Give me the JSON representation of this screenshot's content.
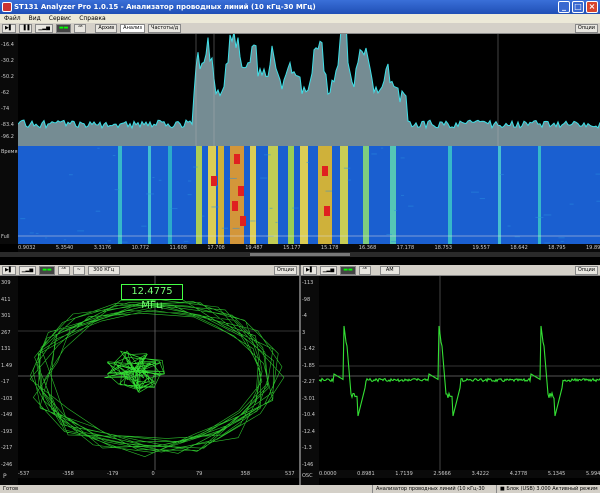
{
  "window": {
    "title": "ST131 Analyzer Pro 1.0.15 - Анализатор проводных линий (10 кГц-30 МГц)",
    "buttons": [
      "_",
      "□",
      "×"
    ]
  },
  "menu": {
    "items": [
      "Файл",
      "Вид",
      "Сервис",
      "Справка"
    ]
  },
  "top_toolbar": {
    "buttons": [
      "▶▌",
      "▐▐",
      "▁▂▅",
      "▬▬",
      "ᴬᴮ"
    ],
    "tabs": [
      "Архив",
      "Анализ",
      "Частоты/д"
    ],
    "options_label": "Опции"
  },
  "spectrum": {
    "y_ticks": [
      "-16.4",
      "-30.2",
      "-50.2",
      "-62",
      "-74",
      "-83.4",
      "-96.2"
    ],
    "waterfall_label": "Время",
    "bottom_label": "Full",
    "x_ticks": [
      "0.9032",
      "5.3540",
      "3.3176",
      "10.772",
      "11.608",
      "17.708",
      "19.487",
      "15.177",
      "15.178",
      "16.368",
      "17.178",
      "18.753",
      "19.557",
      "18.642",
      "18.795",
      "19.897"
    ]
  },
  "left_panel": {
    "toolbar": {
      "buttons": [
        "▶▌",
        "▁▂▅",
        "▬▬",
        "ᴬᴮ",
        "~"
      ],
      "bandwidth": "300 КГц",
      "options_label": "Опции"
    },
    "freq_label": "12.4775 МГц",
    "y_ticks": [
      "309",
      "411",
      "301",
      "267",
      "131",
      "1.49",
      "-17",
      "-103",
      "-149",
      "-193",
      "-217",
      "-246"
    ],
    "x_ticks": [
      "-537",
      "-358",
      "-179",
      "0",
      "79",
      "358",
      "537"
    ],
    "corner_label": "Р"
  },
  "right_panel": {
    "toolbar": {
      "buttons": [
        "▶▌",
        "▁▂▅",
        "▬▬",
        "ᴬᴮ"
      ],
      "mode": "АМ",
      "options_label": "Опции"
    },
    "y_ticks": [
      "-113",
      "-98",
      "-4",
      "3",
      "-1.42",
      "-1.85",
      "-2.27",
      "-3.01",
      "-10.4",
      "-12.4",
      "-1.3",
      "-146"
    ],
    "x_ticks": [
      "0.0000",
      "0.8981",
      "1.7139",
      "2.5666",
      "3.4222",
      "4.2778",
      "5.1345",
      "5.9946"
    ],
    "corner_label": "ОSC"
  },
  "status": {
    "left": "Готов",
    "mid": "Анализатор проводных линий (10 кГц-30 МГц)",
    "right": "■ Блок (USB) 3.000 Активный режим"
  },
  "colors": {
    "spectrum": "#3fe0e8",
    "spectrum_fill": "#8aa4ad",
    "trace": "#34e034",
    "waterfall_bg": "#1a5fd0"
  }
}
